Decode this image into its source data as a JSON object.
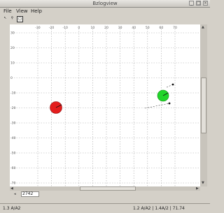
{
  "window": {
    "title": "Bzlogview"
  },
  "menu": {
    "file": "File",
    "view": "View",
    "help": "Help"
  },
  "toolbar": {
    "tool1": "↖",
    "tool2": "⚲",
    "tool3": "▢"
  },
  "ruler": {
    "x_ticks": [
      "-30",
      "-20",
      "-10",
      "0",
      "10",
      "20",
      "30",
      "40",
      "50",
      "60",
      "70"
    ],
    "y_ticks": [
      "30",
      "20",
      "10",
      "0",
      "-10",
      "-20",
      "-30",
      "-40",
      "-50",
      "-60",
      "-70"
    ]
  },
  "zoom": {
    "value": "2742"
  },
  "status": {
    "left": "1.3 A/A2",
    "right": "1.2 A/A2 | 1.4A/2 | 71.74"
  }
}
